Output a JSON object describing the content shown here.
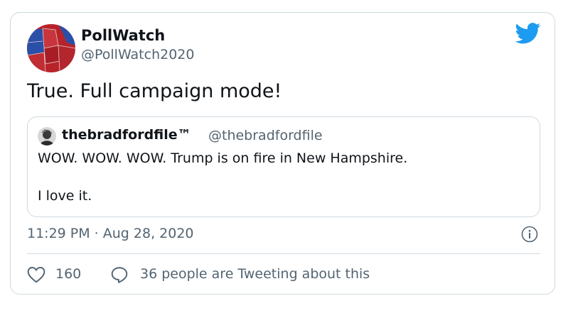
{
  "author": {
    "name": "PollWatch",
    "handle": "@PollWatch2020"
  },
  "tweet": {
    "text": "True. Full campaign mode!"
  },
  "quote": {
    "name": "thebradfordfile™",
    "handle": "@thebradfordfile",
    "line1": "WOW. WOW. WOW. Trump is on fire in New Hampshire.",
    "line2": "I love it."
  },
  "meta": {
    "timestamp": "11:29 PM · Aug 28, 2020"
  },
  "footer": {
    "likes": "160",
    "tweeting": "36 people are Tweeting about this"
  },
  "icons": {
    "brand": "twitter-bird-icon",
    "info": "info-icon",
    "like": "heart-icon",
    "reply": "speech-bubble-icon"
  },
  "colors": {
    "brand": "#1d9bf0",
    "secondary_text": "#536471",
    "border": "#cfd9de"
  }
}
